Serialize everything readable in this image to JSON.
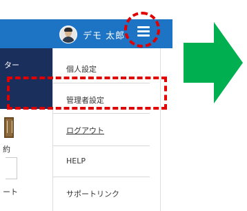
{
  "header": {
    "user_name": "デモ 太郎",
    "avatar": "user-photo",
    "menu_icon": "hamburger-menu-icon"
  },
  "background": {
    "panel_text": "ター",
    "partial_text_1": "約",
    "partial_text_2": "ート"
  },
  "menu": {
    "items": [
      {
        "label": "個人設定"
      },
      {
        "label": "管理者設定"
      },
      {
        "label": "ログアウト"
      },
      {
        "label": "HELP"
      },
      {
        "label": "サポートリンク"
      }
    ]
  },
  "colors": {
    "header_blue": "#1d74c5",
    "dark_panel": "#1b2f5c",
    "highlight_red": "#e00000",
    "arrow_green": "#00b050"
  }
}
